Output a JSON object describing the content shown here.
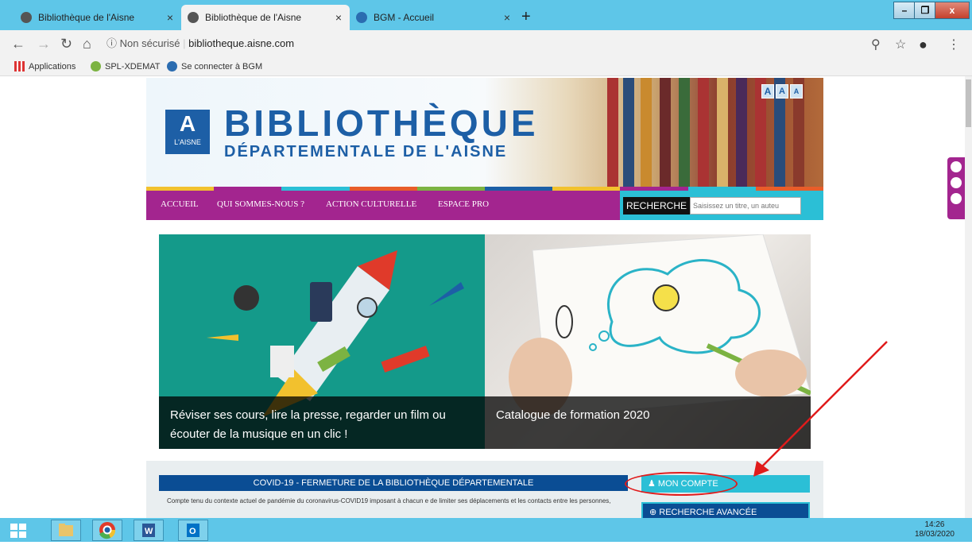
{
  "browser": {
    "tabs": [
      {
        "title": "Bibliothèque de l'Aisne",
        "active": false
      },
      {
        "title": "Bibliothèque de l'Aisne",
        "active": true
      },
      {
        "title": "BGM - Accueil",
        "active": false
      }
    ],
    "new_tab": "+",
    "close_glyph": "×",
    "address": {
      "security": "Non sécurisé",
      "url": "bibliotheque.aisne.com"
    },
    "bookmarks": [
      "Applications",
      "SPL-XDEMAT",
      "Se connecter à BGM"
    ]
  },
  "site": {
    "logo_text": "L'AISNE",
    "title_line1": "BIBLIOTHÈQUE",
    "title_line2": "DÉPARTEMENTALE DE L'AISNE",
    "font_size_buttons": [
      "A",
      "A",
      "A"
    ],
    "menu": [
      "ACCUEIL",
      "QUI SOMMES-NOUS ?",
      "ACTION CULTURELLE",
      "ESPACE PRO"
    ],
    "search_button": "RECHERCHE",
    "search_placeholder": "Saisissez un titre, un auteu",
    "slides": [
      {
        "caption": "Réviser ses cours, lire la presse, regarder un film ou écouter de la musique en un clic !"
      },
      {
        "caption": "Catalogue de formation 2020"
      }
    ],
    "covid_title": "COVID-19 - FERMETURE DE LA BIBLIOTHÈQUE DÉPARTEMENTALE",
    "covid_text": "Compte tenu du contexte actuel de pandémie du coronavirus-COVID19 imposant à chacun e de limiter ses déplacements et les contacts entre les personnes,",
    "mon_compte": "MON COMPTE",
    "recherche_avancee": "RECHERCHE AVANCÉE"
  },
  "taskbar": {
    "time": "14:26",
    "date": "18/03/2020"
  },
  "colors": {
    "brand_blue": "#1d5fa6",
    "menu_magenta": "#a3258f",
    "cyan": "#2bbfd6",
    "annotation_red": "#e01b1b"
  }
}
